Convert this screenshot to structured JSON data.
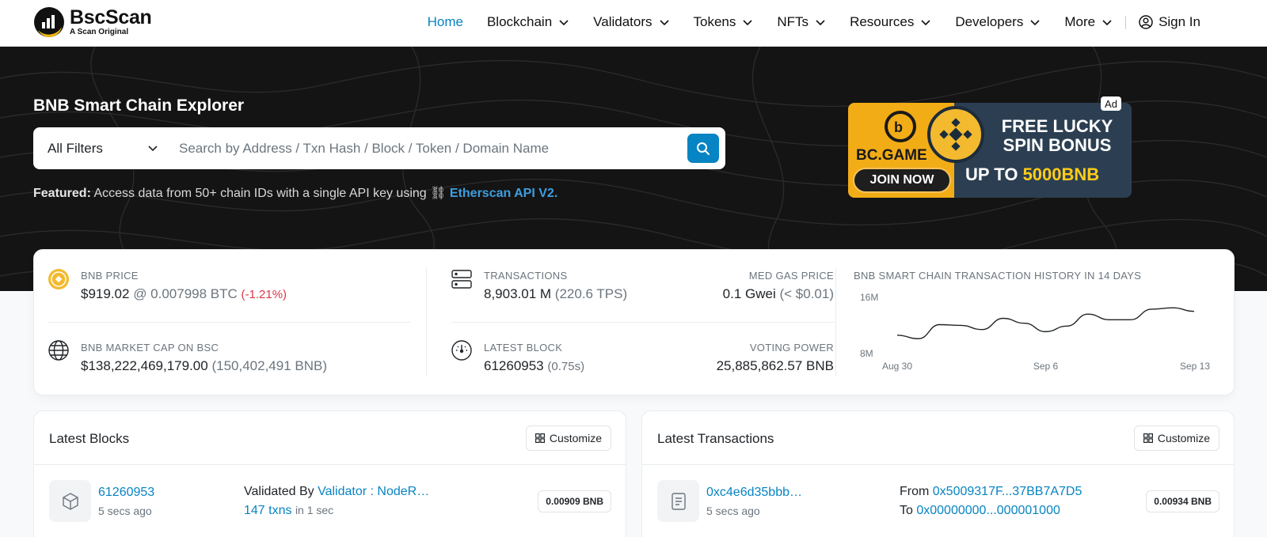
{
  "header": {
    "brand": "BscScan",
    "tagline": "A Scan Original",
    "nav": [
      {
        "label": "Home"
      },
      {
        "label": "Blockchain"
      },
      {
        "label": "Validators"
      },
      {
        "label": "Tokens"
      },
      {
        "label": "NFTs"
      },
      {
        "label": "Resources"
      },
      {
        "label": "Developers"
      },
      {
        "label": "More"
      }
    ],
    "sign_in": "Sign In"
  },
  "hero": {
    "title": "BNB Smart Chain Explorer",
    "filter_label": "All Filters",
    "search_placeholder": "Search by Address / Txn Hash / Block / Token / Domain Name",
    "featured_label": "Featured:",
    "featured_text": "Access data from 50+ chain IDs with a single API key using",
    "featured_link": "Etherscan API V2.",
    "ad": {
      "badge": "Ad",
      "brand": "BC.GAME",
      "cta": "JOIN NOW",
      "headline": "FREE LUCKY SPIN BONUS",
      "offer_prefix": "UP TO",
      "offer_amount": "5000BNB"
    }
  },
  "stats": {
    "bnb_price": {
      "label": "BNB PRICE",
      "price": "$919.02",
      "btc": "@ 0.007998 BTC",
      "change": "(-1.21%)"
    },
    "market_cap": {
      "label": "BNB MARKET CAP ON BSC",
      "value": "$138,222,469,179.00",
      "sub": "(150,402,491 BNB)"
    },
    "transactions": {
      "label": "TRANSACTIONS",
      "value": "8,903.01 M",
      "sub": "(220.6 TPS)"
    },
    "gas": {
      "label": "MED GAS PRICE",
      "value": "0.1 Gwei",
      "sub": "(< $0.01)"
    },
    "latest_block": {
      "label": "LATEST BLOCK",
      "value": "61260953",
      "sub": "(0.75s)"
    },
    "voting_power": {
      "label": "VOTING POWER",
      "value": "25,885,862.57 BNB"
    },
    "chart_title": "BNB SMART CHAIN TRANSACTION HISTORY IN 14 DAYS"
  },
  "chart_data": {
    "type": "line",
    "title": "BNB SMART CHAIN TRANSACTION HISTORY IN 14 DAYS",
    "x": [
      "Aug 30",
      "Aug 31",
      "Sep 1",
      "Sep 2",
      "Sep 3",
      "Sep 4",
      "Sep 5",
      "Sep 6",
      "Sep 7",
      "Sep 8",
      "Sep 9",
      "Sep 10",
      "Sep 11",
      "Sep 12",
      "Sep 13"
    ],
    "series": [
      {
        "values": [
          10.5,
          10.0,
          12.0,
          11.9,
          11.3,
          12.9,
          12.2,
          11.0,
          11.8,
          13.5,
          12.7,
          12.7,
          14.2,
          14.4,
          13.9
        ]
      }
    ],
    "xticks": [
      "Aug 30",
      "Sep 6",
      "Sep 13"
    ],
    "yticks": [
      "16M",
      "8M"
    ],
    "ylim": [
      8,
      16
    ],
    "grid": false
  },
  "latest_blocks": {
    "title": "Latest Blocks",
    "customize": "Customize",
    "row": {
      "block": "61260953",
      "age": "5 secs ago",
      "validated_by": "Validated By",
      "validator": "Validator : NodeR…",
      "txns": "147 txns",
      "txns_time": "in 1 sec",
      "reward": "0.00909 BNB"
    }
  },
  "latest_transactions": {
    "title": "Latest Transactions",
    "customize": "Customize",
    "row": {
      "hash": "0xc4e6d35bbb…",
      "age": "5 secs ago",
      "from_label": "From",
      "from": "0x5009317F...37BB7A7D5",
      "to_label": "To",
      "to": "0x00000000...000001000",
      "amount": "0.00934 BNB"
    }
  }
}
